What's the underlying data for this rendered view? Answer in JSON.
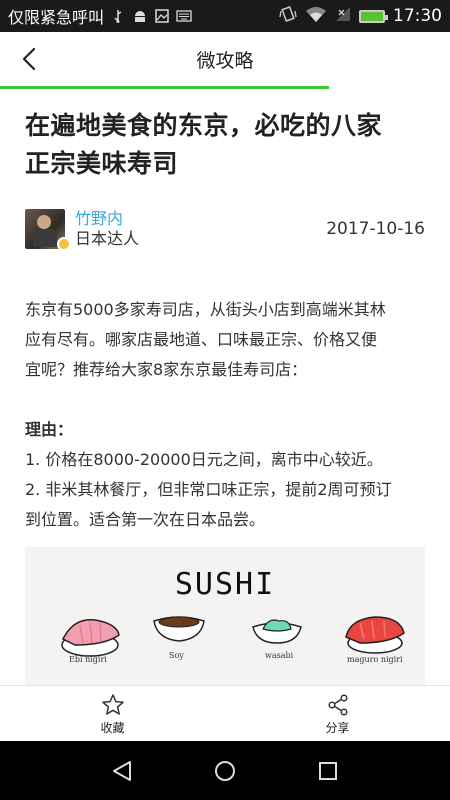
{
  "status_bar": {
    "carrier": "仅限紧急呼叫",
    "time": "17:30",
    "icons": [
      "usb-icon",
      "android-icon",
      "image-icon",
      "keyboard-icon",
      "vibrate-icon",
      "wifi-icon",
      "no-signal-icon",
      "battery-icon"
    ]
  },
  "header": {
    "title": "微攻略",
    "back_icon": "chevron-left-icon",
    "read_progress": 0.73,
    "accent_color": "#38c83a"
  },
  "article": {
    "title_line1": "在遍地美食的东京，必吃的八家",
    "title_line2": "正宗美味寿司",
    "author": {
      "name": "竹野内",
      "tag": "日本达人",
      "name_color": "#3aa9d8"
    },
    "date": "2017-10-16",
    "intro_line1": "东京有5000多家寿司店，从街头小店到高端米其林",
    "intro_line2": "应有尽有。哪家店最地道、口味最正宗、价格又便",
    "intro_line3": "宜呢？推荐给大家8家东京最佳寿司店：",
    "reason_heading": "理由：",
    "reason1": "1. 价格在8000-20000日元之间，离市中心较近。",
    "reason2_line1": "2. 非米其林餐厅，但非常口味正宗，提前2周可预订",
    "reason2_line2": "到位置。适合第一次在日本品尝。",
    "image": {
      "title": "SUSHI",
      "labels": [
        "Ebi nigiri",
        "Soy",
        "wasabi",
        "maguro nigiri"
      ]
    }
  },
  "toolbar": {
    "favorite_label": "收藏",
    "share_label": "分享"
  },
  "nav": {
    "icons": [
      "back-triangle-icon",
      "home-circle-icon",
      "recents-square-icon"
    ]
  }
}
